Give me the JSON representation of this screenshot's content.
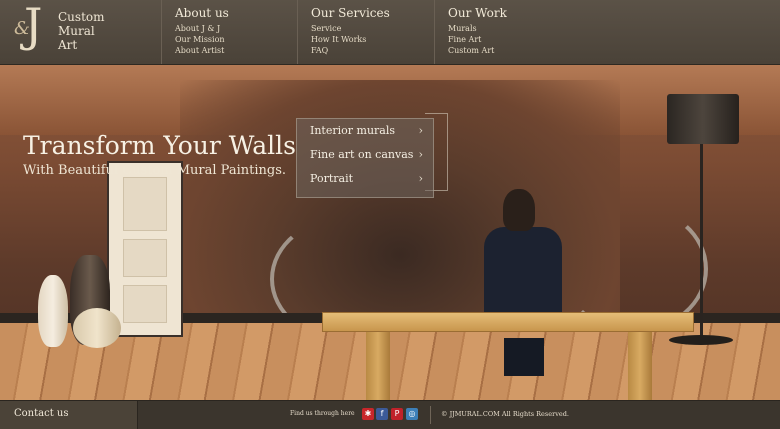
{
  "logo": {
    "monogram": "J",
    "ampersand": "&",
    "lines": [
      "Custom",
      "Mural",
      "Art"
    ]
  },
  "nav": [
    {
      "title": "About us",
      "links": [
        "About J & J",
        "Our Mission",
        "About Artist"
      ]
    },
    {
      "title": "Our Services",
      "links": [
        "Service",
        "How It Works",
        "FAQ"
      ]
    },
    {
      "title": "Our Work",
      "links": [
        "Murals",
        "Fine Art",
        "Custom Art"
      ]
    }
  ],
  "hero": {
    "title": "Transform Your Walls",
    "subtitle": "With Beautiful Custom Mural Paintings."
  },
  "menu": {
    "items": [
      "Interior murals",
      "Fine art on canvas",
      "Portrait"
    ],
    "chevron": "›"
  },
  "footer": {
    "contact": "Contact us",
    "find_text": "Find us through here",
    "copyright": "© JJMURAL.COM All Rights Reserved.",
    "social": [
      {
        "name": "yelp",
        "glyph": "✱",
        "color": "#c8262a"
      },
      {
        "name": "facebook",
        "glyph": "f",
        "color": "#3c5a98"
      },
      {
        "name": "pinterest",
        "glyph": "P",
        "color": "#c0222a"
      },
      {
        "name": "instagram",
        "glyph": "◎",
        "color": "#3d7fb8"
      }
    ]
  }
}
